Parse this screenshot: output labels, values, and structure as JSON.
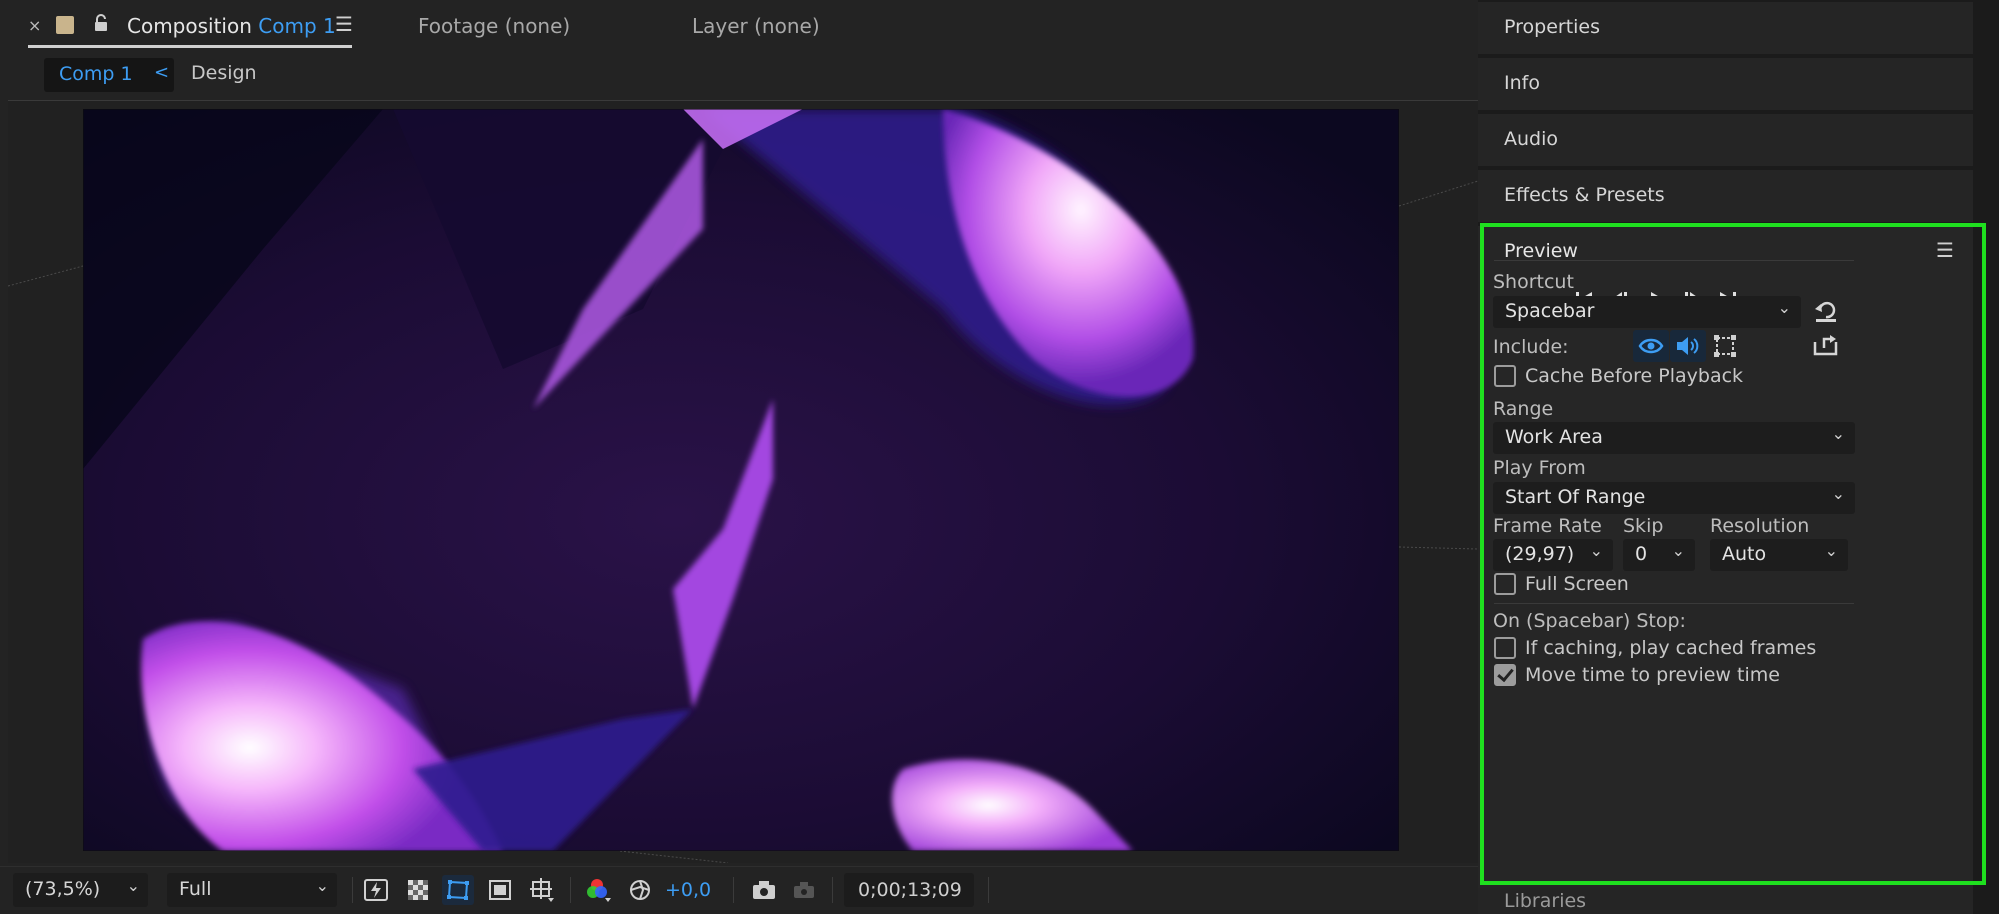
{
  "comp_panel": {
    "close_glyph": "×",
    "title_prefix": "Composition",
    "title_comp": "Comp 1",
    "menu_glyph": "☰",
    "footage_tab": "Footage (none)",
    "layer_tab": "Layer (none)",
    "breadcrumb_comp": "Comp 1",
    "breadcrumb_chevron": "<",
    "breadcrumb_design": "Design"
  },
  "toolbar": {
    "zoom": "(73,5%)",
    "resolution": "Full",
    "exposure": "+0,0",
    "timecode": "0;00;13;09",
    "dropdown_glyph": "⌄"
  },
  "right_panels": {
    "properties": "Properties",
    "info": "Info",
    "audio": "Audio",
    "effects": "Effects & Presets",
    "library": "Libraries"
  },
  "preview": {
    "title": "Preview",
    "menu_glyph": "☰",
    "shortcut_label": "Shortcut",
    "shortcut_value": "Spacebar",
    "include_label": "Include:",
    "cache_before_playback": "Cache Before Playback",
    "range_label": "Range",
    "range_value": "Work Area",
    "play_from_label": "Play From",
    "play_from_value": "Start Of Range",
    "frame_rate_label": "Frame Rate",
    "skip_label": "Skip",
    "resolution_label": "Resolution",
    "frame_rate_value": "(29,97)",
    "skip_value": "0",
    "resolution_value": "Auto",
    "full_screen": "Full Screen",
    "on_stop_label": "On (Spacebar) Stop:",
    "if_caching": "If caching, play cached frames",
    "move_time": "Move time to preview time",
    "cache_checked": false,
    "full_screen_checked": false,
    "if_caching_checked": false,
    "move_time_checked": true
  },
  "colors": {
    "accent": "#3d9df3",
    "highlight": "#1fe01f",
    "panel_bg": "#262626"
  }
}
